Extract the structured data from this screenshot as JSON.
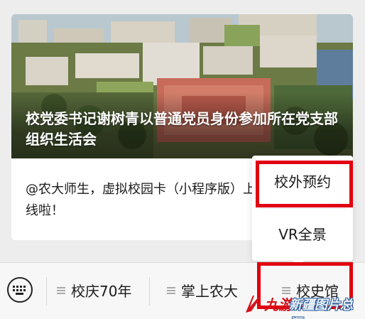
{
  "article": {
    "headline": "校党委书记谢树青以普通党员身份参加所在党支部组织生活会",
    "summary": "@农大师生，虚拟校园卡（小程序版）上线啦！"
  },
  "popup_menu": {
    "items": [
      {
        "label": "校外预约"
      },
      {
        "label": "VR全景"
      }
    ]
  },
  "bottom_menu": {
    "items": [
      {
        "label": "校庆70年"
      },
      {
        "label": "掌上农大"
      },
      {
        "label": "校史馆"
      }
    ]
  },
  "highlight_color": "#e0000f",
  "watermark": {
    "logo_text": "九游",
    "text": "新疆图片总汇"
  }
}
